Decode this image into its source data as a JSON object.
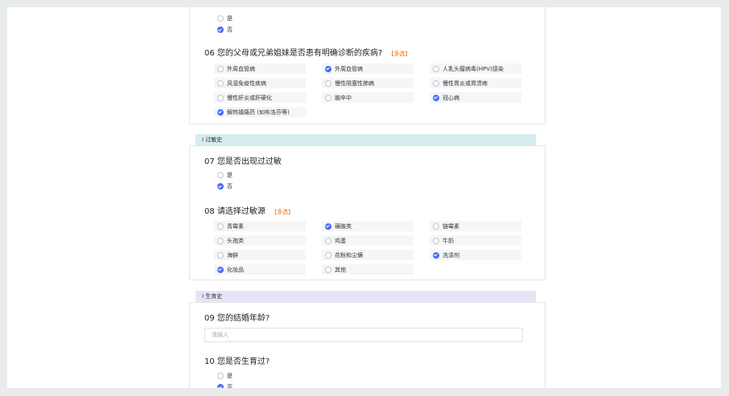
{
  "q05": {
    "options": [
      {
        "label": "是",
        "checked": false
      },
      {
        "label": "否",
        "checked": true
      }
    ]
  },
  "q06": {
    "number": "06",
    "title": "您的父母或兄弟姐妹是否患有明确诊断的疾病?",
    "tag": "【多选】",
    "options": [
      {
        "label": "外周血管病",
        "checked": false
      },
      {
        "label": "外周血管病",
        "checked": true
      },
      {
        "label": "人乳头瘤病毒(HPV)感染",
        "checked": false
      },
      {
        "label": "风湿免疫性疾病",
        "checked": false
      },
      {
        "label": "慢性阻塞性肺病",
        "checked": false
      },
      {
        "label": "慢性胃炎或胃溃疡",
        "checked": false
      },
      {
        "label": "慢性肝炎或肝硬化",
        "checked": false
      },
      {
        "label": "脑卒中",
        "checked": false
      },
      {
        "label": "冠心病",
        "checked": true
      },
      {
        "label": "解热镇痛药 (如布洛芬等)",
        "checked": true
      }
    ]
  },
  "section_allergy": {
    "label": "I 过敏史"
  },
  "q07": {
    "number": "07",
    "title": "您是否出现过过敏",
    "options": [
      {
        "label": "是",
        "checked": false
      },
      {
        "label": "否",
        "checked": true
      }
    ]
  },
  "q08": {
    "number": "08",
    "title": "请选择过敏源",
    "tag": "【多选】",
    "options": [
      {
        "label": "青霉素",
        "checked": false
      },
      {
        "label": "磺胺类",
        "checked": true
      },
      {
        "label": "链霉素",
        "checked": false
      },
      {
        "label": "头孢类",
        "checked": false
      },
      {
        "label": "鸡蛋",
        "checked": false
      },
      {
        "label": "牛奶",
        "checked": false
      },
      {
        "label": "海鲜",
        "checked": false
      },
      {
        "label": "花粉和尘螨",
        "checked": false
      },
      {
        "label": "洗涤剂",
        "checked": true
      },
      {
        "label": "化妆品",
        "checked": true
      },
      {
        "label": "其他",
        "checked": false
      }
    ]
  },
  "section_birth": {
    "label": "I 生育史"
  },
  "q09": {
    "number": "09",
    "title": "您的结婚年龄?",
    "placeholder": "请输入",
    "value": ""
  },
  "q10": {
    "number": "10",
    "title": "您是否生育过?",
    "options": [
      {
        "label": "是",
        "checked": false
      },
      {
        "label": "否",
        "checked": true
      }
    ]
  },
  "colors": {
    "accent": "#4a6cf7",
    "multi_tag": "#ff6a00",
    "allergy_bar": "#d6ecef",
    "birth_bar": "#e7e3f7"
  }
}
